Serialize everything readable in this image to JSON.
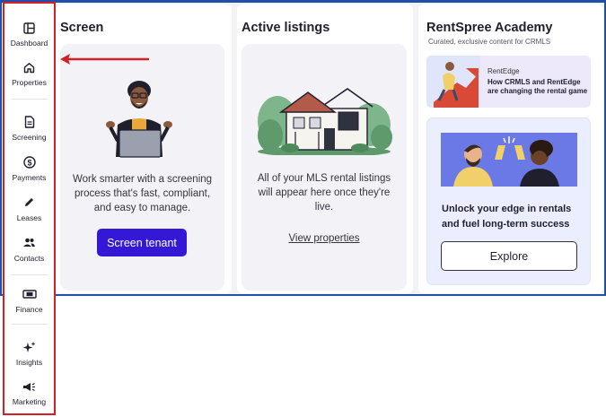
{
  "sidebar": {
    "items": [
      {
        "label": "Dashboard",
        "icon": "dashboard-icon"
      },
      {
        "label": "Properties",
        "icon": "home-icon"
      },
      {
        "label": "Screening",
        "icon": "document-icon"
      },
      {
        "label": "Payments",
        "icon": "dollar-icon"
      },
      {
        "label": "Leases",
        "icon": "pencil-icon"
      },
      {
        "label": "Contacts",
        "icon": "people-icon"
      },
      {
        "label": "Finance",
        "icon": "money-icon"
      },
      {
        "label": "Insights",
        "icon": "sparkle-icon"
      },
      {
        "label": "Marketing",
        "icon": "megaphone-icon"
      }
    ]
  },
  "screen_card": {
    "title": "Screen",
    "description": "Work smarter with a screening process that's fast, compliant, and easy to manage.",
    "button": "Screen tenant"
  },
  "listings_card": {
    "title": "Active listings",
    "description": "All of your MLS rental listings will appear here once they're live.",
    "link": "View properties"
  },
  "academy_card": {
    "title": "RentSpree Academy",
    "subtitle": "Curated, exclusive content for CRMLS",
    "article": {
      "tag": "RentEdge",
      "title": "How CRMLS and RentEdge are changing the rental game"
    },
    "promo": {
      "text": "Unlock your edge in rentals and fuel long-term success",
      "button": "Explore"
    }
  },
  "colors": {
    "accent": "#3319d6",
    "annotation": "#d41f26",
    "frame": "#1f4fa8"
  }
}
